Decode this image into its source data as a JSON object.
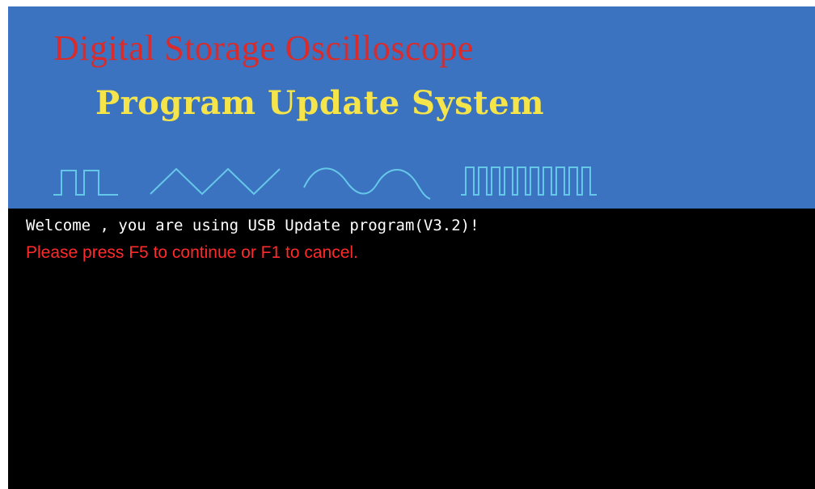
{
  "banner": {
    "title": "Digital Storage Oscilloscope",
    "subtitle": "Program Update System",
    "background_color": "#3b73c0",
    "title_color": "#d92b2b",
    "subtitle_color": "#f5e44a",
    "waveform_color": "#66c8e8",
    "waveforms": [
      {
        "name": "square-pulse-icon"
      },
      {
        "name": "triangle-wave-icon"
      },
      {
        "name": "sine-wave-icon"
      },
      {
        "name": "pulse-train-icon"
      }
    ]
  },
  "console": {
    "background_color": "#000000",
    "welcome_message": "Welcome , you are using USB Update program(V3.2)!",
    "welcome_color": "#ffffff",
    "prompt_message": "Please press  F5 to continue or F1  to cancel.",
    "prompt_color": "#ff2a2a"
  }
}
